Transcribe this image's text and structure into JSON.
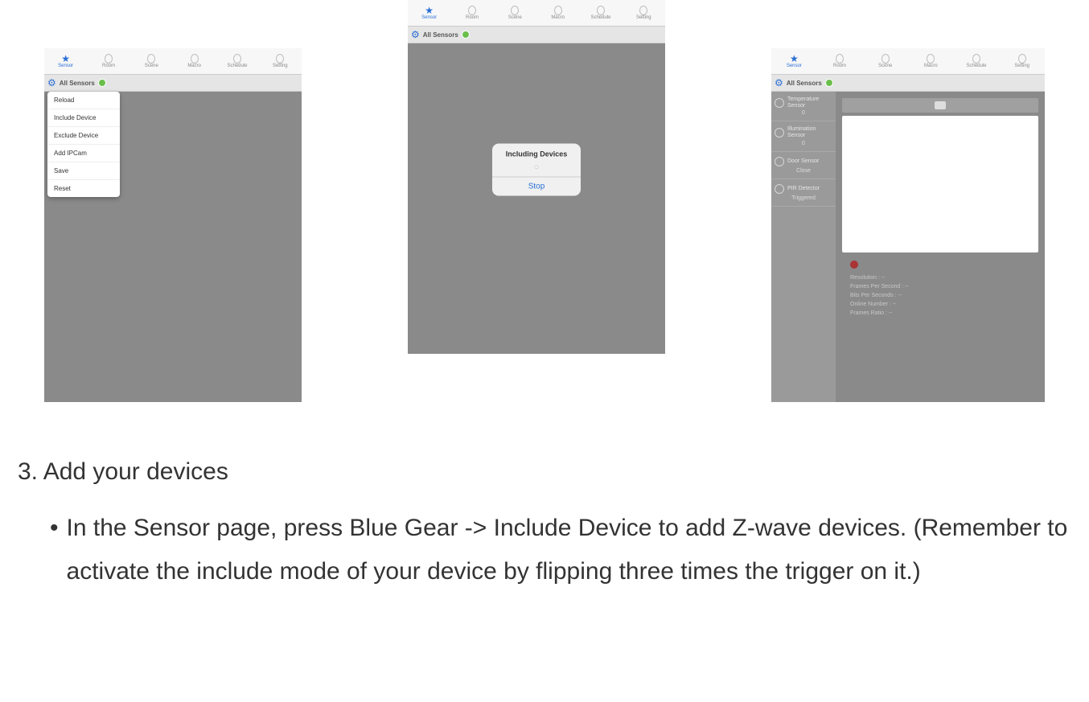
{
  "tabs": [
    {
      "label": "Sensor"
    },
    {
      "label": "Room"
    },
    {
      "label": "Scene"
    },
    {
      "label": "Macro"
    },
    {
      "label": "Schedule"
    },
    {
      "label": "Setting"
    }
  ],
  "sensor_header": {
    "title": "All Sensors"
  },
  "screenshot1": {
    "menu": [
      "Reload",
      "Include Device",
      "Exclude Device",
      "Add IPCam",
      "Save",
      "Reset"
    ]
  },
  "screenshot2": {
    "modal": {
      "title": "Including Devices",
      "button": "Stop"
    }
  },
  "screenshot3": {
    "sidebar": [
      {
        "label": "Temperature Sensor",
        "value": "0"
      },
      {
        "label": "Illumination Sensor",
        "value": "0"
      },
      {
        "label": "Door Sensor",
        "value": "Close"
      },
      {
        "label": "PIR Detector",
        "value": "Triggered"
      }
    ],
    "stats": [
      "Resolution : --",
      "Frames Per Second : --",
      "Bits Per Seconds : --",
      "Online Number : --",
      "Frames Ratio : --"
    ]
  },
  "instructions": {
    "heading": "3. Add your devices",
    "bullet": "In the Sensor page, press Blue Gear -> Include Device to add Z-wave devices.   (Remember to activate the include mode of your device by flipping three times the trigger on it.)"
  }
}
